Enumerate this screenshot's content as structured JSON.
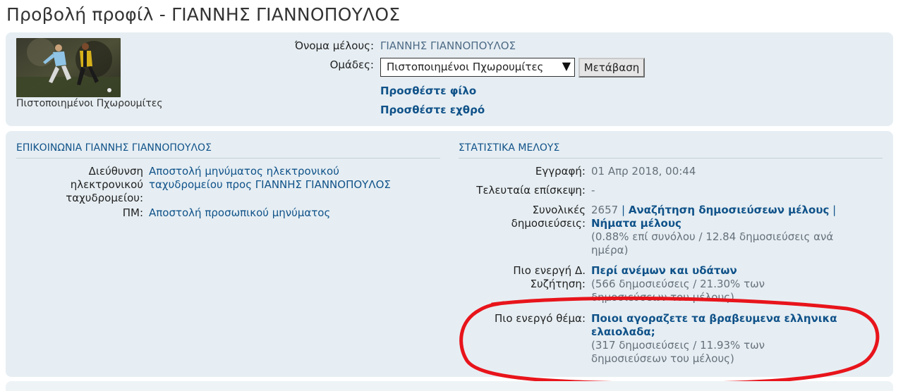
{
  "page_title": "Προβολή προφίλ - ΓΙΑΝΝΗΣ ΓΙΑΝΝΟΠΟΥΛΟΣ",
  "profile": {
    "avatar_caption": "Πιστοποιημένοι Πχωρουμίτες",
    "member_name_label": "Όνομα μέλους:",
    "member_name": "ΓΙΑΝΝΗΣ ΓΙΑΝΝΟΠΟΥΛΟΣ",
    "groups_label": "Ομάδες:",
    "groups_selected": "Πιστοποιημένοι Πχωρουμίτες",
    "go_button": "Μετάβαση",
    "add_friend": "Προσθέστε φίλο",
    "add_foe": "Προσθέστε εχθρό"
  },
  "contact": {
    "heading": "ΕΠΙΚΟΙΝΩΝΙΑ ΓΙΑΝΝΗΣ ΓΙΑΝΝΟΠΟΥΛΟΣ",
    "email_label_1": "Διεύθυνση",
    "email_label_2": "ηλεκτρονικού",
    "email_label_3": "ταχυδρομείου:",
    "email_link_1": "Αποστολή μηνύματος ηλεκτρονικού",
    "email_link_2": "ταχυδρομείου προς ΓΙΑΝΝΗΣ ΓΙΑΝΝΟΠΟΥΛΟΣ",
    "pm_label": "ΠΜ:",
    "pm_link": "Αποστολή προσωπικού μηνύματος"
  },
  "stats": {
    "heading": "ΣΤΑΤΙΣΤΙΚΑ ΜΕΛΟΥΣ",
    "joined_label": "Εγγραφή:",
    "joined_value": "01 Απρ 2018, 00:44",
    "last_visit_label": "Τελευταία επίσκεψη:",
    "last_visit_value": "-",
    "posts_label_1": "Συνολικές",
    "posts_label_2": "δημοσιεύσεις:",
    "posts_count": "2657",
    "posts_sep_1": "|",
    "search_posts": "Αναζήτηση δημοσιεύσεων μέλους",
    "posts_sep_2": "|",
    "member_topics": "Νήματα μέλους",
    "posts_detail_1": "(0.88% επί συνόλου / 12.84 δημοσιεύσεις ανά",
    "posts_detail_2": "ημέρα)",
    "active_forum_label_1": "Πιο ενεργή Δ.",
    "active_forum_label_2": "Συζήτηση:",
    "active_forum": "Περί ανέμων και υδάτων",
    "active_forum_detail_1": "(566 δημοσιεύσεις / 21.30% των",
    "active_forum_detail_2": "δημοσιεύσεων του μέλους)",
    "active_topic_label": "Πιο ενεργό θέμα:",
    "active_topic_1": "Ποιοι αγοραζετε τα βραβευμενα ελληνικα",
    "active_topic_2": "ελαιολαδα;",
    "active_topic_detail_1": "(317 δημοσιεύσεις / 11.93% των",
    "active_topic_detail_2": "δημοσιεύσεων του μέλους)"
  },
  "colors": {
    "panel_bg": "#e6eef3",
    "link": "#105289",
    "highlight_stroke": "#e8141b"
  },
  "icons": {
    "dropdown": "chevron-down-icon"
  }
}
